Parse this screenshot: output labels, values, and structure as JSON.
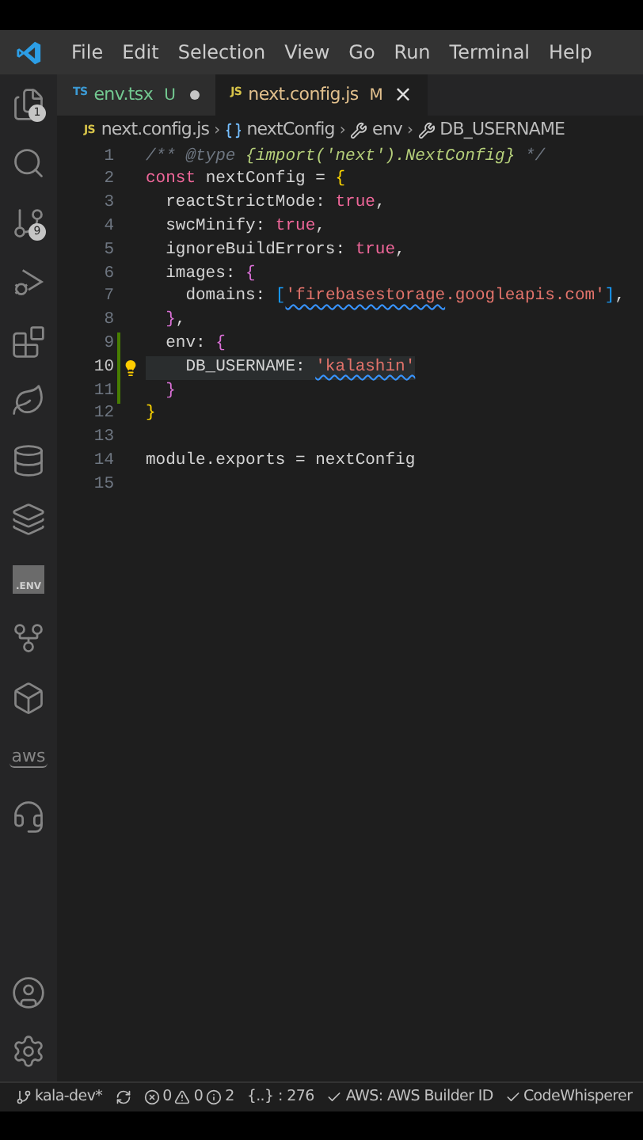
{
  "menu_bar": {
    "items": [
      "File",
      "Edit",
      "Selection",
      "View",
      "Go",
      "Run",
      "Terminal",
      "Help"
    ]
  },
  "activity_bar": {
    "items": [
      {
        "kind": "files",
        "badge": "1"
      },
      {
        "kind": "search"
      },
      {
        "kind": "source-control",
        "badge": "9"
      },
      {
        "kind": "run-debug"
      },
      {
        "kind": "extensions"
      },
      {
        "kind": "leaf"
      },
      {
        "kind": "database"
      },
      {
        "kind": "layers"
      },
      {
        "kind": "env",
        "label": ".ENV"
      },
      {
        "kind": "branch"
      },
      {
        "kind": "cube"
      },
      {
        "kind": "aws",
        "label": "aws"
      },
      {
        "kind": "headset"
      }
    ],
    "bottom_items": [
      {
        "kind": "account"
      },
      {
        "kind": "settings"
      }
    ]
  },
  "tabs": [
    {
      "lang": "TS",
      "label": "env.tsx",
      "status": "U",
      "selected": false,
      "dirty": true
    },
    {
      "lang": "JS",
      "label": "next.config.js",
      "status": "M",
      "selected": true,
      "dirty": false,
      "close": "×"
    }
  ],
  "breadcrumb": [
    {
      "kind": "js",
      "icon_text": "JS",
      "label": "next.config.js"
    },
    {
      "kind": "variable",
      "separator": "›",
      "label": "nextConfig"
    },
    {
      "kind": "property",
      "separator": "›",
      "label": "env"
    },
    {
      "kind": "property",
      "separator": "›",
      "label": "DB_USERNAME"
    }
  ],
  "editor": {
    "lines": [
      {
        "number": "1",
        "changed": false,
        "current": false,
        "lightbulb": false,
        "tokens": [
          {
            "kind": "comment",
            "text": "/** @type "
          },
          {
            "kind": "type",
            "text": "{import('next').NextConfig}"
          },
          {
            "kind": "comment",
            "text": " */"
          }
        ]
      },
      {
        "number": "2",
        "changed": false,
        "current": false,
        "lightbulb": false,
        "tokens": [
          {
            "kind": "keyword",
            "text": "const"
          },
          {
            "kind": "plain",
            "text": " nextConfig = "
          },
          {
            "kind": "bracket1",
            "text": "{"
          }
        ]
      },
      {
        "number": "3",
        "changed": false,
        "current": false,
        "lightbulb": false,
        "tokens": [
          {
            "kind": "plain",
            "text": "  reactStrictMode: "
          },
          {
            "kind": "boolean",
            "text": "true"
          },
          {
            "kind": "plain",
            "text": ","
          }
        ]
      },
      {
        "number": "4",
        "changed": false,
        "current": false,
        "lightbulb": false,
        "tokens": [
          {
            "kind": "plain",
            "text": "  swcMinify: "
          },
          {
            "kind": "boolean",
            "text": "true"
          },
          {
            "kind": "plain",
            "text": ","
          }
        ]
      },
      {
        "number": "5",
        "changed": false,
        "current": false,
        "lightbulb": false,
        "tokens": [
          {
            "kind": "plain",
            "text": "  ignoreBuildErrors: "
          },
          {
            "kind": "boolean",
            "text": "true"
          },
          {
            "kind": "plain",
            "text": ","
          }
        ]
      },
      {
        "number": "6",
        "changed": false,
        "current": false,
        "lightbulb": false,
        "tokens": [
          {
            "kind": "plain",
            "text": "  images: "
          },
          {
            "kind": "bracket2",
            "text": "{"
          }
        ]
      },
      {
        "number": "7",
        "changed": false,
        "current": false,
        "lightbulb": false,
        "tokens": [
          {
            "kind": "plain",
            "text": "    domains: "
          },
          {
            "kind": "bracket3",
            "text": "["
          },
          {
            "kind": "string",
            "text": "'firebasestorage",
            "squiggle": true
          },
          {
            "kind": "string",
            "text": ".googleapis.com'"
          },
          {
            "kind": "bracket3",
            "text": "]"
          },
          {
            "kind": "plain",
            "text": ","
          }
        ]
      },
      {
        "number": "8",
        "changed": false,
        "current": false,
        "lightbulb": false,
        "tokens": [
          {
            "kind": "bracket2",
            "text": "  }"
          },
          {
            "kind": "plain",
            "text": ","
          }
        ]
      },
      {
        "number": "9",
        "changed": true,
        "current": false,
        "lightbulb": false,
        "tokens": [
          {
            "kind": "plain",
            "text": "  env: "
          },
          {
            "kind": "bracket2",
            "text": "{"
          }
        ]
      },
      {
        "number": "10",
        "changed": true,
        "current": true,
        "lightbulb": true,
        "tokens": [
          {
            "kind": "plain",
            "text": "    DB_USERNAME: "
          },
          {
            "kind": "string",
            "text": "'kalashin'",
            "squiggle": true
          }
        ]
      },
      {
        "number": "11",
        "changed": true,
        "current": false,
        "lightbulb": false,
        "tokens": [
          {
            "kind": "bracket2",
            "text": "  }"
          }
        ]
      },
      {
        "number": "12",
        "changed": false,
        "current": false,
        "lightbulb": false,
        "tokens": [
          {
            "kind": "bracket1",
            "text": "}"
          }
        ]
      },
      {
        "number": "13",
        "changed": false,
        "current": false,
        "lightbulb": false
      },
      {
        "number": "14",
        "changed": false,
        "current": false,
        "lightbulb": false,
        "tokens": [
          {
            "kind": "plain",
            "text": "module.exports = nextConfig"
          }
        ]
      },
      {
        "number": "15",
        "changed": false,
        "current": false,
        "lightbulb": false
      }
    ]
  },
  "status_bar": {
    "branch": "kala-dev*",
    "errors": "0",
    "warnings": "0",
    "infos": "2",
    "selection": "{..} : 276",
    "aws": "AWS: AWS Builder ID",
    "codewhisperer": "CodeWhisperer"
  }
}
